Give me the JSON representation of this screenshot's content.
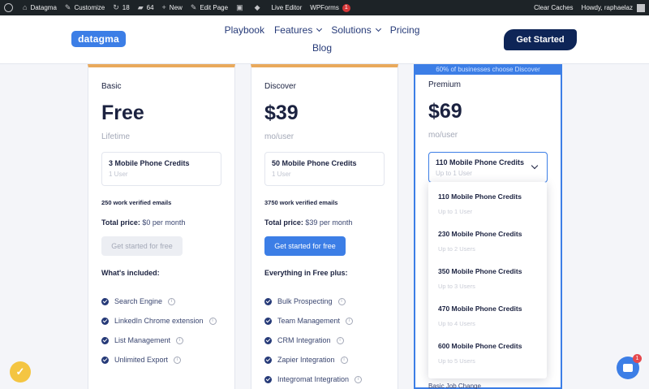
{
  "adminbar": {
    "site": "Datagma",
    "customize": "Customize",
    "updates": "18",
    "comments": "64",
    "new": "New",
    "edit_page": "Edit Page",
    "live_editor": "Live Editor",
    "wpforms": "WPForms",
    "wpforms_badge": "1",
    "clear_caches": "Clear Caches",
    "howdy": "Howdy, raphaelaz"
  },
  "header": {
    "logo": "datagma",
    "nav": [
      "Playbook",
      "Features",
      "Solutions",
      "Pricing",
      "Blog"
    ],
    "cta": "Get Started"
  },
  "plans": {
    "basic": {
      "name": "Basic",
      "price": "Free",
      "price_sub": "Lifetime",
      "credit_title": "3 Mobile Phone Credits",
      "credit_sub": "1 User",
      "emails": "250 work verified emails",
      "total_label": "Total price:",
      "total_value": "$0 per month",
      "cta": "Get started for free",
      "included_title": "What's included:",
      "features": [
        "Search Engine",
        "LinkedIn Chrome extension",
        "List Management",
        "Unlimited Export"
      ]
    },
    "discover": {
      "name": "Discover",
      "price": "$39",
      "price_sub": "mo/user",
      "credit_title": "50 Mobile Phone Credits",
      "credit_sub": "1 User",
      "emails": "3750 work verified emails",
      "total_label": "Total price:",
      "total_value": "$39 per month",
      "cta": "Get started for free",
      "included_title": "Everything in Free plus:",
      "features": [
        "Bulk Prospecting",
        "Team Management",
        "CRM Integration",
        "Zapier Integration",
        "Integromat Integration"
      ]
    },
    "premium": {
      "banner": "60% of businesses choose Discover",
      "name": "Premium",
      "price": "$69",
      "price_sub": "mo/user",
      "select_title": "110 Mobile Phone Credits",
      "select_sub": "Up to 1 User",
      "peek": "Basic Job Change"
    }
  },
  "dropdown": [
    {
      "title": "110 Mobile Phone Credits",
      "sub": "Up to 1 User"
    },
    {
      "title": "230 Mobile Phone Credits",
      "sub": "Up to 2 Users"
    },
    {
      "title": "350 Mobile Phone Credits",
      "sub": "Up to 3 Users"
    },
    {
      "title": "470 Mobile Phone Credits",
      "sub": "Up to 4 Users"
    },
    {
      "title": "600 Mobile Phone Credits",
      "sub": "Up to 5 Users"
    }
  ],
  "chat": {
    "badge": "1"
  },
  "colors": {
    "accent": "#3c7ee6",
    "navy": "#0e2557",
    "orange": "#e9a95c"
  }
}
